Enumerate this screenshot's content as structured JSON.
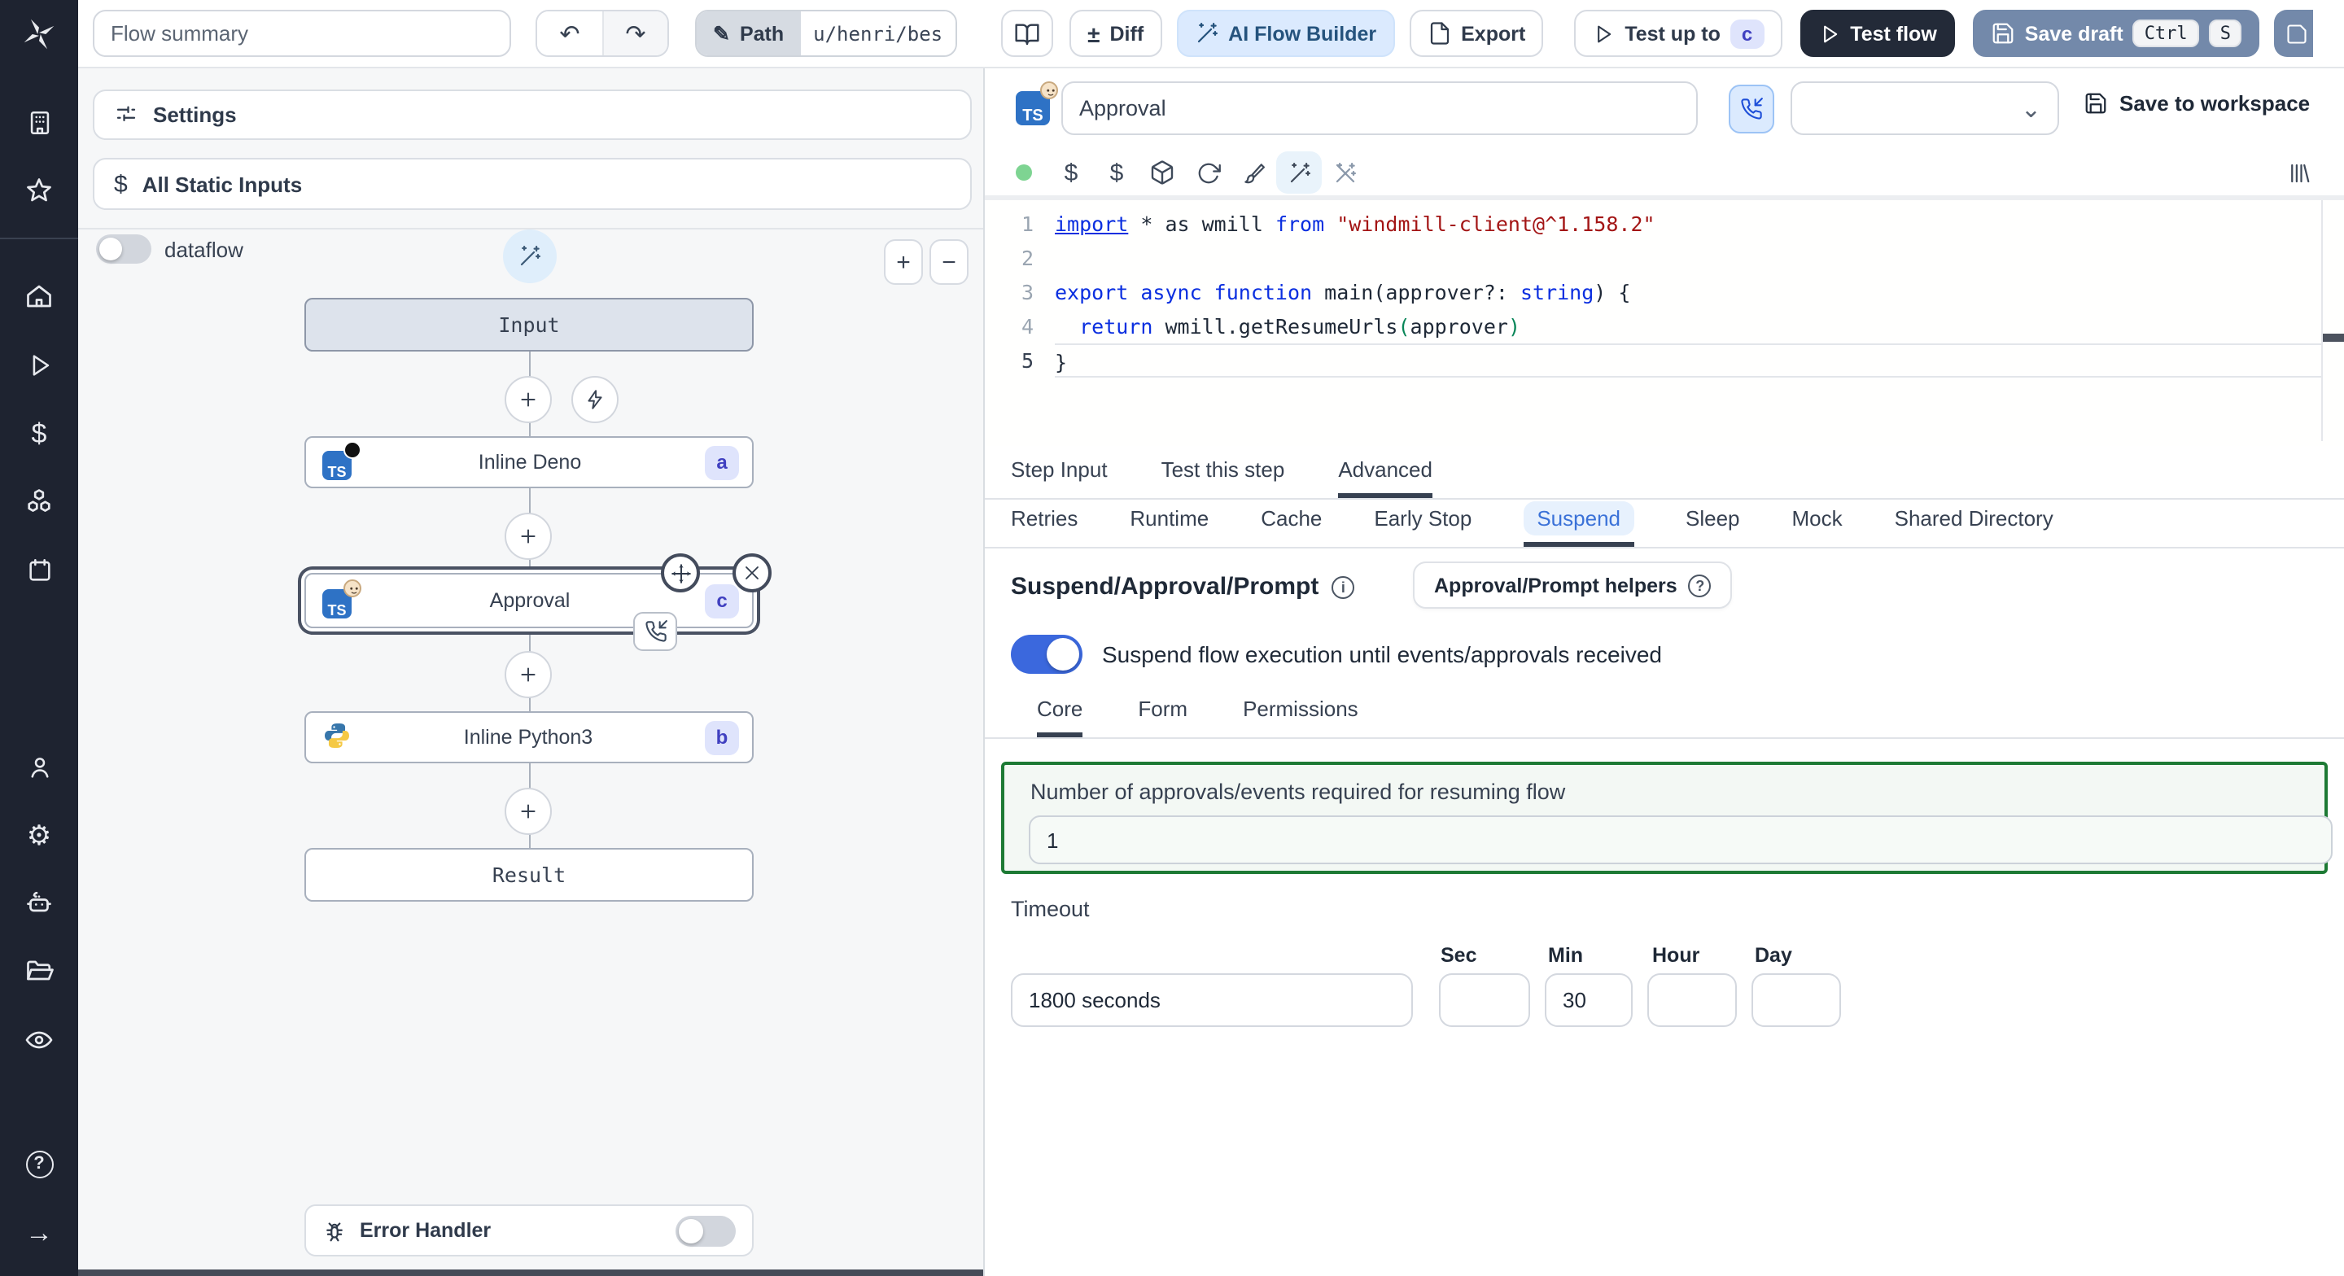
{
  "topbar": {
    "flow_summary_placeholder": "Flow summary",
    "path_label": "Path",
    "path_value": "u/henri/bes",
    "diff_label": "Diff",
    "ai_flow_builder_label": "AI Flow Builder",
    "export_label": "Export",
    "test_up_to_label": "Test up to",
    "test_up_to_badge": "c",
    "test_flow_label": "Test flow",
    "save_draft_label": "Save draft",
    "save_draft_kbd": [
      "Ctrl",
      "S"
    ]
  },
  "icons": {
    "diff": "±",
    "undo": "↶",
    "redo": "↷",
    "pencil": "✎",
    "chevron_down": "⌄",
    "gear": "⚙",
    "dollar": "$",
    "close": "×",
    "help": "?",
    "arrow_right": "→",
    "info": "i",
    "sidebar_icon_names": [
      "building",
      "star",
      "home",
      "play",
      "dollar",
      "cubes",
      "calendar",
      "user",
      "settings",
      "robot",
      "folder",
      "eye",
      "help-circle",
      "arrow-right"
    ],
    "toolbar_icon_names": [
      "status-dot",
      "dollar",
      "dollar",
      "package",
      "refresh",
      "brush",
      "magic-wand",
      "wand-off",
      "bars"
    ]
  },
  "left_panel": {
    "settings_label": "Settings",
    "static_inputs_label": "All Static Inputs",
    "dataflow_label": "dataflow",
    "zoom_in": "+",
    "zoom_out": "−",
    "error_handler_label": "Error Handler",
    "graph": {
      "input_label": "Input",
      "result_label": "Result",
      "steps": [
        {
          "label": "Inline Deno",
          "badge": "a",
          "lang": "typescript-deno"
        },
        {
          "label": "Approval",
          "badge": "c",
          "lang": "typescript-bun"
        },
        {
          "label": "Inline Python3",
          "badge": "b",
          "lang": "python3"
        }
      ]
    }
  },
  "step_editor": {
    "name_value": "Approval",
    "save_to_workspace_label": "Save to workspace",
    "code": {
      "line_numbers": [
        "1",
        "2",
        "3",
        "4",
        "5"
      ],
      "l1_kw1": "import",
      "l1_t1": " * as wmill ",
      "l1_kw2": "from",
      "l1_str": " \"windmill-client@^1.158.2\"",
      "l3_kw": "export async function",
      "l3_t1": " main(approver?: ",
      "l3_ty": "string",
      "l3_t2": ") {",
      "l4_kw": "  return",
      "l4_t1": " wmill.getResumeUrls",
      "l4_p1": "(",
      "l4_t2": "approver",
      "l4_p2": ")",
      "l5_t": "}"
    },
    "tabs": [
      "Step Input",
      "Test this step",
      "Advanced"
    ],
    "subtabs": [
      "Retries",
      "Runtime",
      "Cache",
      "Early Stop",
      "Suspend",
      "Sleep",
      "Mock",
      "Shared Directory"
    ],
    "suspend": {
      "heading": "Suspend/Approval/Prompt",
      "helpers_button": "Approval/Prompt helpers",
      "toggle_label": "Suspend flow execution until events/approvals received",
      "tabs": [
        "Core",
        "Form",
        "Permissions"
      ],
      "approvals_label": "Number of approvals/events required for resuming flow",
      "approvals_value": "1",
      "timeout_label": "Timeout",
      "timeout_value": "1800 seconds",
      "unit_labels": [
        "Sec",
        "Min",
        "Hour",
        "Day"
      ],
      "min_value": "30"
    }
  },
  "colors": {
    "accent_blue": "#3b68dd",
    "badge_bg": "#dfe4fc",
    "badge_text": "#4040c0",
    "approvals_box_border": "#1d7a34",
    "sidebar_bg": "#1e2330",
    "test_flow_bg": "#232a38",
    "save_draft_bg": "#7389aa",
    "ai_builder_bg": "#dbeafe"
  }
}
